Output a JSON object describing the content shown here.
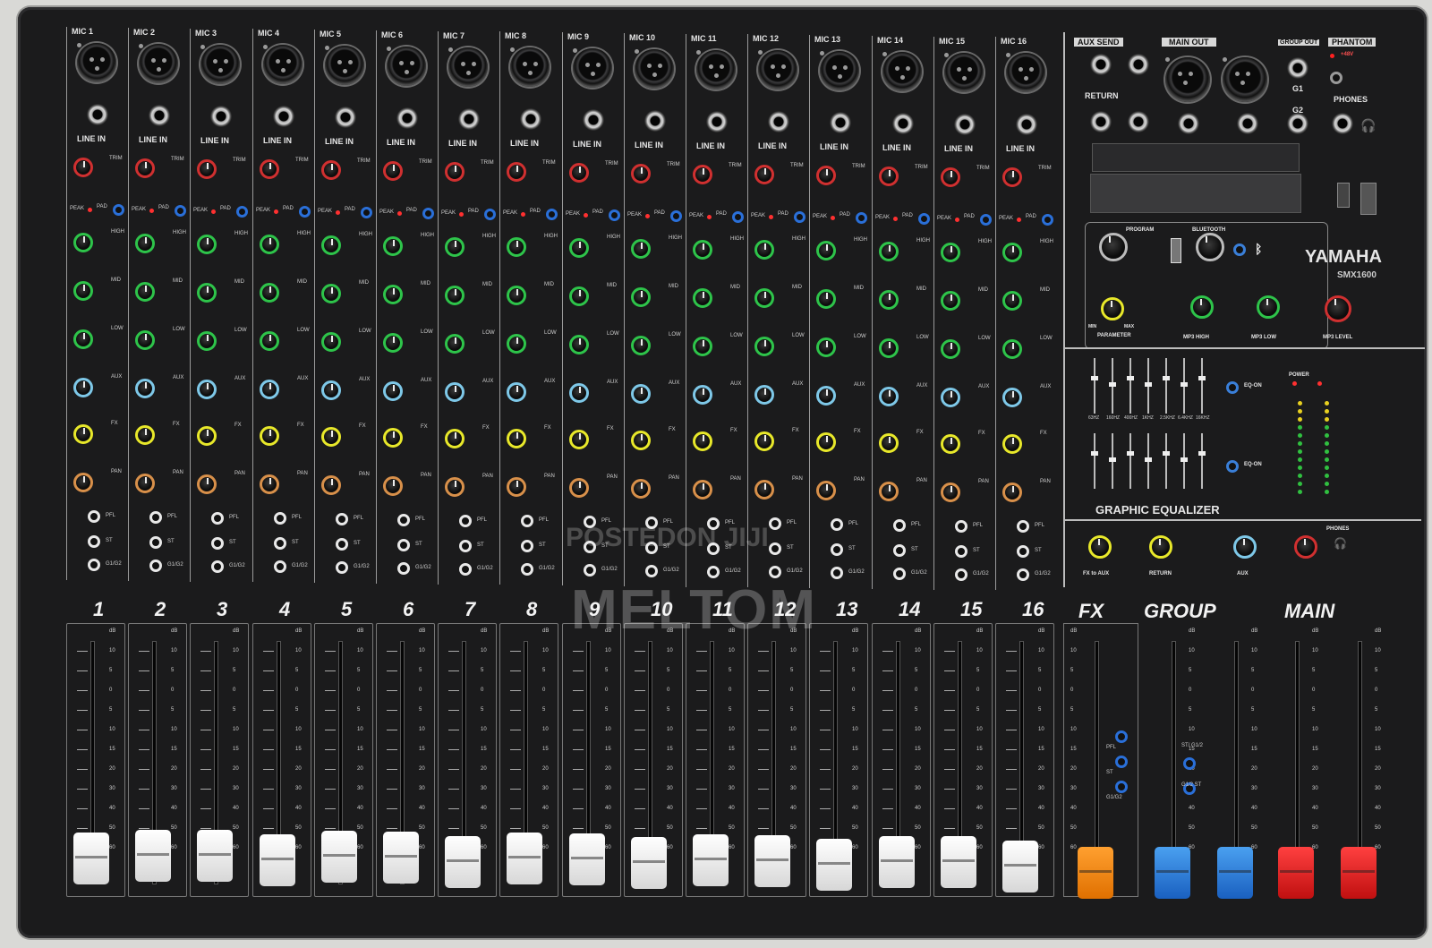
{
  "brand": {
    "name": "YAMAHA",
    "model": "SMX1600"
  },
  "channels": [
    {
      "mic": "MIC 1",
      "num": "1"
    },
    {
      "mic": "MIC 2",
      "num": "2"
    },
    {
      "mic": "MIC 3",
      "num": "3"
    },
    {
      "mic": "MIC 4",
      "num": "4"
    },
    {
      "mic": "MIC 5",
      "num": "5"
    },
    {
      "mic": "MIC 6",
      "num": "6"
    },
    {
      "mic": "MIC 7",
      "num": "7"
    },
    {
      "mic": "MIC 8",
      "num": "8"
    },
    {
      "mic": "MIC 9",
      "num": "9"
    },
    {
      "mic": "MIC 10",
      "num": "10"
    },
    {
      "mic": "MIC 11",
      "num": "11"
    },
    {
      "mic": "MIC 12",
      "num": "12"
    },
    {
      "mic": "MIC 13",
      "num": "13"
    },
    {
      "mic": "MIC 14",
      "num": "14"
    },
    {
      "mic": "MIC 15",
      "num": "15"
    },
    {
      "mic": "MIC 16",
      "num": "16"
    }
  ],
  "channel_labels": {
    "line_in": "LINE IN",
    "trim": "TRIM",
    "peak": "PEAK",
    "pad": "PAD",
    "high": "HIGH",
    "mid": "MID",
    "low": "LOW",
    "aux": "AUX",
    "fx": "FX",
    "pan": "PAN",
    "pfl": "PFL",
    "st": "ST",
    "g1g2": "G1/G2"
  },
  "master": {
    "aux_send": "AUX  SEND",
    "main_out": "MAIN OUT",
    "group_out": "GROUP OUT",
    "phantom": "PHANTOM",
    "return": "RETURN",
    "g1": "G1",
    "g2": "G2",
    "phones": "PHONES",
    "plus48": "+48V",
    "program": "PROGRAM",
    "bluetooth": "BLUETOOTH",
    "parameter": "PARAMETER",
    "mp3_high": "MP3 HIGH",
    "mp3_low": "MP3 LOW",
    "mp3_level": "MP3 LEVEL",
    "eq_on": "EQ-ON",
    "power": "POWER",
    "graphic_eq": "GRAPHIC EQUALIZER",
    "fx_to_aux": "FX to AUX",
    "return_knob": "RETURN",
    "aux_knob": "AUX",
    "phones_knob": "PHONES",
    "min": "MIN",
    "max": "MAX"
  },
  "sections": {
    "fx": "FX",
    "group": "GROUP",
    "main": "MAIN"
  },
  "fader_scale": [
    "dB",
    "10",
    "5",
    "0",
    "5",
    "10",
    "15",
    "20",
    "30",
    "40",
    "50",
    "60"
  ],
  "fx_buttons": [
    "PFL",
    "ST",
    "G1/G2"
  ],
  "group_buttons": [
    "ST/ G1/2",
    "G1/2 ST"
  ],
  "geq_freqs": [
    "63HZ",
    "160HZ",
    "400HZ",
    "1KHZ",
    "2.5KHZ",
    "6.4KHZ",
    "16KHZ"
  ],
  "watermarks": {
    "posted": "POSTEDON JIJI",
    "seller": "MELTOM"
  },
  "colors": {
    "panel": "#1b1b1c",
    "trim_ring": "#d03030",
    "eq_ring": "#2ec44a",
    "aux_ring": "#7ec8e8",
    "fx_ring": "#e8e82a",
    "pan_ring": "#d8904a",
    "pad_button": "#2a6fd8",
    "fader_white": "#f2f2f2",
    "fader_fx": "#f08a10",
    "fader_group": "#2a7ed8",
    "fader_main": "#e02020"
  }
}
